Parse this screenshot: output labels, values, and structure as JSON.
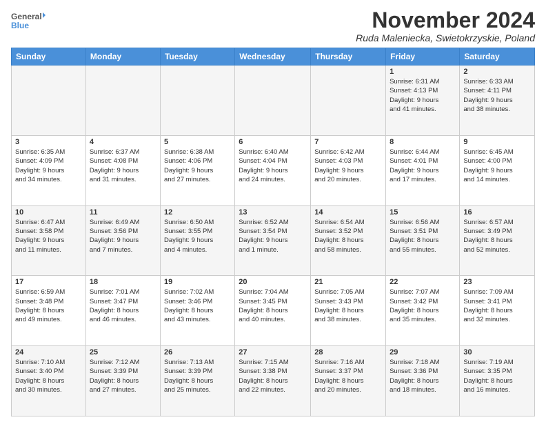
{
  "logo": {
    "general": "General",
    "blue": "Blue"
  },
  "title": "November 2024",
  "location": "Ruda Maleniecka, Swietokrzyskie, Poland",
  "headers": [
    "Sunday",
    "Monday",
    "Tuesday",
    "Wednesday",
    "Thursday",
    "Friday",
    "Saturday"
  ],
  "weeks": [
    [
      {
        "day": "",
        "info": ""
      },
      {
        "day": "",
        "info": ""
      },
      {
        "day": "",
        "info": ""
      },
      {
        "day": "",
        "info": ""
      },
      {
        "day": "",
        "info": ""
      },
      {
        "day": "1",
        "info": "Sunrise: 6:31 AM\nSunset: 4:13 PM\nDaylight: 9 hours\nand 41 minutes."
      },
      {
        "day": "2",
        "info": "Sunrise: 6:33 AM\nSunset: 4:11 PM\nDaylight: 9 hours\nand 38 minutes."
      }
    ],
    [
      {
        "day": "3",
        "info": "Sunrise: 6:35 AM\nSunset: 4:09 PM\nDaylight: 9 hours\nand 34 minutes."
      },
      {
        "day": "4",
        "info": "Sunrise: 6:37 AM\nSunset: 4:08 PM\nDaylight: 9 hours\nand 31 minutes."
      },
      {
        "day": "5",
        "info": "Sunrise: 6:38 AM\nSunset: 4:06 PM\nDaylight: 9 hours\nand 27 minutes."
      },
      {
        "day": "6",
        "info": "Sunrise: 6:40 AM\nSunset: 4:04 PM\nDaylight: 9 hours\nand 24 minutes."
      },
      {
        "day": "7",
        "info": "Sunrise: 6:42 AM\nSunset: 4:03 PM\nDaylight: 9 hours\nand 20 minutes."
      },
      {
        "day": "8",
        "info": "Sunrise: 6:44 AM\nSunset: 4:01 PM\nDaylight: 9 hours\nand 17 minutes."
      },
      {
        "day": "9",
        "info": "Sunrise: 6:45 AM\nSunset: 4:00 PM\nDaylight: 9 hours\nand 14 minutes."
      }
    ],
    [
      {
        "day": "10",
        "info": "Sunrise: 6:47 AM\nSunset: 3:58 PM\nDaylight: 9 hours\nand 11 minutes."
      },
      {
        "day": "11",
        "info": "Sunrise: 6:49 AM\nSunset: 3:56 PM\nDaylight: 9 hours\nand 7 minutes."
      },
      {
        "day": "12",
        "info": "Sunrise: 6:50 AM\nSunset: 3:55 PM\nDaylight: 9 hours\nand 4 minutes."
      },
      {
        "day": "13",
        "info": "Sunrise: 6:52 AM\nSunset: 3:54 PM\nDaylight: 9 hours\nand 1 minute."
      },
      {
        "day": "14",
        "info": "Sunrise: 6:54 AM\nSunset: 3:52 PM\nDaylight: 8 hours\nand 58 minutes."
      },
      {
        "day": "15",
        "info": "Sunrise: 6:56 AM\nSunset: 3:51 PM\nDaylight: 8 hours\nand 55 minutes."
      },
      {
        "day": "16",
        "info": "Sunrise: 6:57 AM\nSunset: 3:49 PM\nDaylight: 8 hours\nand 52 minutes."
      }
    ],
    [
      {
        "day": "17",
        "info": "Sunrise: 6:59 AM\nSunset: 3:48 PM\nDaylight: 8 hours\nand 49 minutes."
      },
      {
        "day": "18",
        "info": "Sunrise: 7:01 AM\nSunset: 3:47 PM\nDaylight: 8 hours\nand 46 minutes."
      },
      {
        "day": "19",
        "info": "Sunrise: 7:02 AM\nSunset: 3:46 PM\nDaylight: 8 hours\nand 43 minutes."
      },
      {
        "day": "20",
        "info": "Sunrise: 7:04 AM\nSunset: 3:45 PM\nDaylight: 8 hours\nand 40 minutes."
      },
      {
        "day": "21",
        "info": "Sunrise: 7:05 AM\nSunset: 3:43 PM\nDaylight: 8 hours\nand 38 minutes."
      },
      {
        "day": "22",
        "info": "Sunrise: 7:07 AM\nSunset: 3:42 PM\nDaylight: 8 hours\nand 35 minutes."
      },
      {
        "day": "23",
        "info": "Sunrise: 7:09 AM\nSunset: 3:41 PM\nDaylight: 8 hours\nand 32 minutes."
      }
    ],
    [
      {
        "day": "24",
        "info": "Sunrise: 7:10 AM\nSunset: 3:40 PM\nDaylight: 8 hours\nand 30 minutes."
      },
      {
        "day": "25",
        "info": "Sunrise: 7:12 AM\nSunset: 3:39 PM\nDaylight: 8 hours\nand 27 minutes."
      },
      {
        "day": "26",
        "info": "Sunrise: 7:13 AM\nSunset: 3:39 PM\nDaylight: 8 hours\nand 25 minutes."
      },
      {
        "day": "27",
        "info": "Sunrise: 7:15 AM\nSunset: 3:38 PM\nDaylight: 8 hours\nand 22 minutes."
      },
      {
        "day": "28",
        "info": "Sunrise: 7:16 AM\nSunset: 3:37 PM\nDaylight: 8 hours\nand 20 minutes."
      },
      {
        "day": "29",
        "info": "Sunrise: 7:18 AM\nSunset: 3:36 PM\nDaylight: 8 hours\nand 18 minutes."
      },
      {
        "day": "30",
        "info": "Sunrise: 7:19 AM\nSunset: 3:35 PM\nDaylight: 8 hours\nand 16 minutes."
      }
    ]
  ]
}
